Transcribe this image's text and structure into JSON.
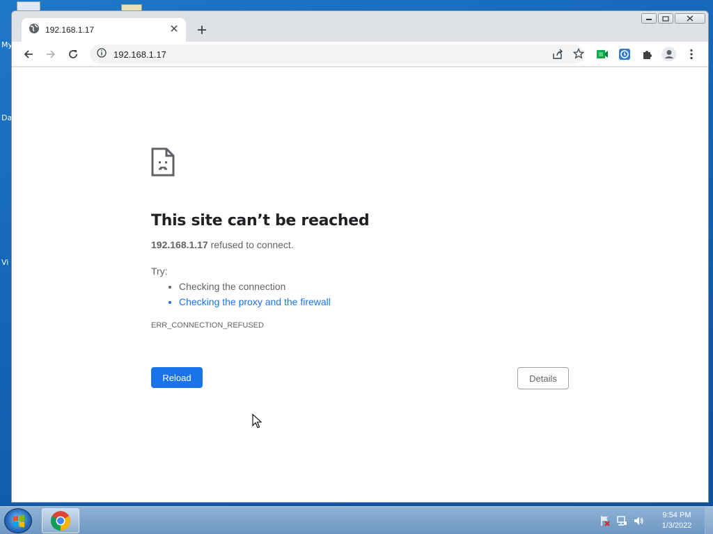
{
  "desktop": {
    "labels": [
      "My",
      "Da",
      "Vi"
    ]
  },
  "tab": {
    "title": "192.168.1.17",
    "favicon": "globe-icon"
  },
  "omnibox": {
    "url": "192.168.1.17"
  },
  "error": {
    "title": "This site can’t be reached",
    "host": "192.168.1.17",
    "desc_suffix": " refused to connect.",
    "try_label": "Try:",
    "suggestions": [
      "Checking the connection",
      "Checking the proxy and the firewall"
    ],
    "code": "ERR_CONNECTION_REFUSED",
    "reload_label": "Reload",
    "details_label": "Details"
  },
  "taskbar": {
    "time": "9:54 PM",
    "date": "1/3/2022"
  },
  "colors": {
    "accent": "#1a73e8",
    "link": "#1a73e8",
    "text_secondary": "#5f6368"
  }
}
